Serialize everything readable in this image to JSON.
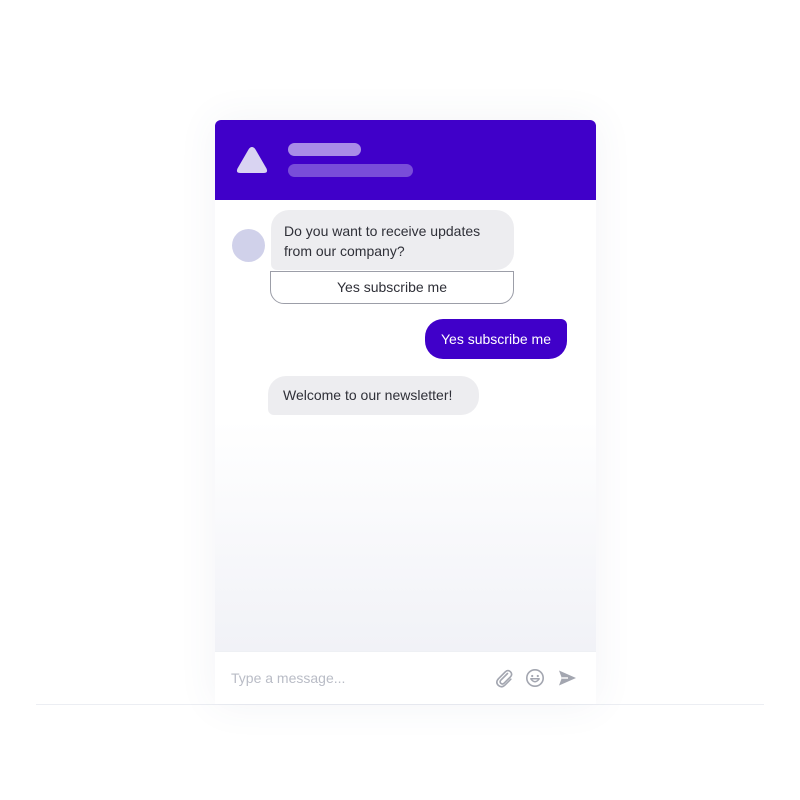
{
  "header": {
    "logo_icon": "triangle-logo-icon",
    "brand_color": "#4000c9"
  },
  "messages": [
    {
      "sender": "bot",
      "lines": [
        "Do you want to receive updates",
        "from our company?"
      ]
    },
    {
      "sender": "user",
      "text": "Yes subscribe me"
    },
    {
      "sender": "bot",
      "text": "Welcome to our newsletter!"
    }
  ],
  "quick_reply": {
    "label": "Yes subscribe me"
  },
  "composer": {
    "placeholder": "Type a message...",
    "icons": [
      "paperclip-icon",
      "emoji-icon",
      "send-icon"
    ]
  }
}
